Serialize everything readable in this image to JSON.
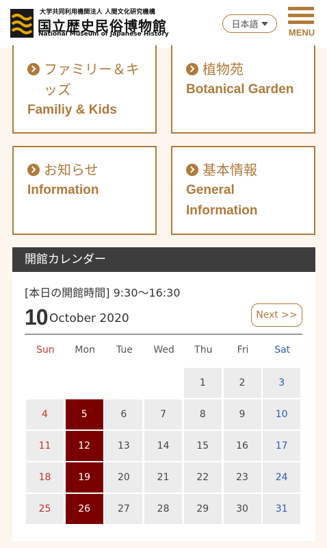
{
  "header": {
    "org_line": "大学共同利用機関法人 人間文化研究機構",
    "museum_jp": "国立歴史民俗博物館",
    "museum_en": "National Museum of Japanese History",
    "language": "日本語",
    "menu_label": "MENU",
    "logo_icon": "rekihaku-logo-icon",
    "menu_icon": "hamburger-icon",
    "accent_color": "#b07a3b"
  },
  "cards": [
    {
      "jp": "ファミリー＆キッズ",
      "en": "Familiy & Kids"
    },
    {
      "jp": "植物苑",
      "en": "Botanical Garden"
    },
    {
      "jp": "お知らせ",
      "en": "Information"
    },
    {
      "jp": "基本情報",
      "en": "General Information"
    }
  ],
  "calendar": {
    "title": "開館カレンダー",
    "hours": "[本日の開館時間]  9:30〜16:30",
    "month_number": "10",
    "month_name": "October 2020",
    "next_label": "Next >>",
    "weekdays": [
      "Sun",
      "Mon",
      "Tue",
      "Wed",
      "Thu",
      "Fri",
      "Sat"
    ],
    "weeks": [
      [
        "",
        "",
        "",
        "",
        "1",
        "2",
        "3"
      ],
      [
        "4",
        "5",
        "6",
        "7",
        "8",
        "9",
        "10"
      ],
      [
        "11",
        "12",
        "13",
        "14",
        "15",
        "16",
        "17"
      ],
      [
        "18",
        "19",
        "20",
        "21",
        "22",
        "23",
        "24"
      ],
      [
        "25",
        "26",
        "27",
        "28",
        "29",
        "30",
        "31"
      ]
    ],
    "closed_days": [
      "5",
      "12",
      "19",
      "26"
    ],
    "closed_color": "#7a0000",
    "sunday_color": "#c0392b",
    "saturday_color": "#2c5fb8"
  }
}
